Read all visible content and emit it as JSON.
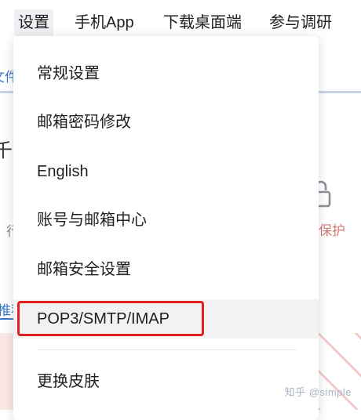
{
  "topnav": {
    "items": [
      "设置",
      "手机App",
      "下载桌面端",
      "参与调研"
    ]
  },
  "background": {
    "frag_left_tab": "文件",
    "frag_left_char": "千",
    "frag_left_small": "行",
    "frag_right_protect": "保护",
    "frag_left_recommend": "推荐"
  },
  "menu": {
    "items": [
      "常规设置",
      "邮箱密码修改",
      "English",
      "账号与邮箱中心",
      "邮箱安全设置",
      "POP3/SMTP/IMAP",
      "更换皮肤"
    ]
  },
  "watermark": "知乎 @simple",
  "colors": {
    "highlight_border": "#e02020",
    "accent": "#3c78c8"
  }
}
